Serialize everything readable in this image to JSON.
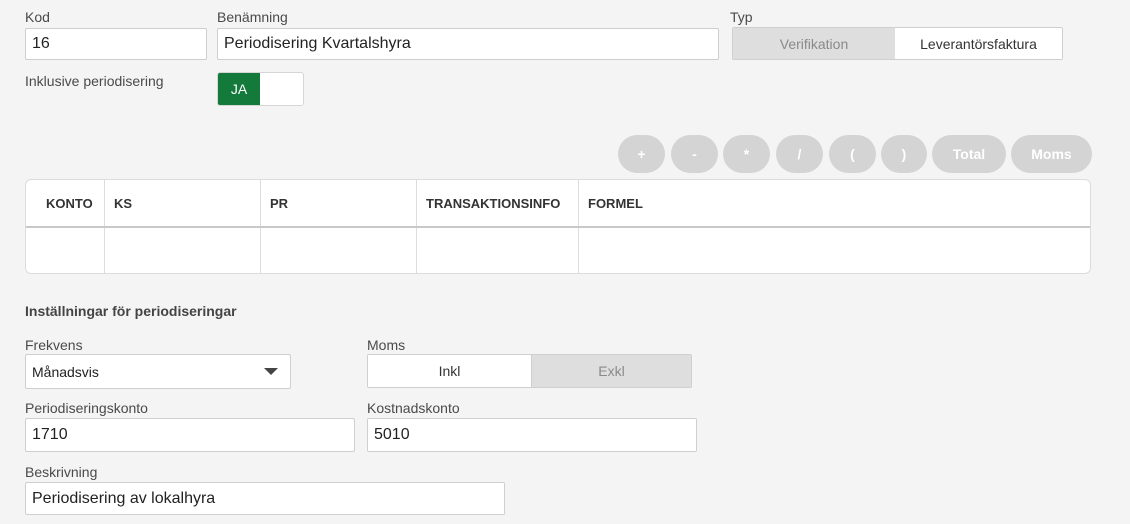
{
  "form": {
    "kod_label": "Kod",
    "kod_value": "16",
    "benamning_label": "Benämning",
    "benamning_value": "Periodisering Kvartalshyra",
    "typ_label": "Typ",
    "typ_options": [
      "Verifikation",
      "Leverantörsfaktura"
    ],
    "typ_selected": "Leverantörsfaktura",
    "periodisering_label": "Inklusive periodisering",
    "toggle_on_label": "JA",
    "toggle_value": true
  },
  "formula_buttons": [
    "+",
    "-",
    "*",
    "/",
    "(",
    ")",
    "Total",
    "Moms"
  ],
  "table": {
    "columns": [
      "KONTO",
      "KS",
      "PR",
      "TRANSAKTIONSINFO",
      "FORMEL"
    ]
  },
  "settings": {
    "title": "Inställningar för periodiseringar",
    "frekvens_label": "Frekvens",
    "frekvens_value": "Månadsvis",
    "moms_label": "Moms",
    "moms_options": [
      "Inkl",
      "Exkl"
    ],
    "moms_selected": "Inkl",
    "periodiseringskonto_label": "Periodiseringskonto",
    "periodiseringskonto_value": "1710",
    "kostnadskonto_label": "Kostnadskonto",
    "kostnadskonto_value": "5010",
    "beskrivning_label": "Beskrivning",
    "beskrivning_value": "Periodisering av lokalhyra"
  },
  "colors": {
    "accent_green": "#137a3b",
    "disabled_grey": "#d4d4d4"
  }
}
